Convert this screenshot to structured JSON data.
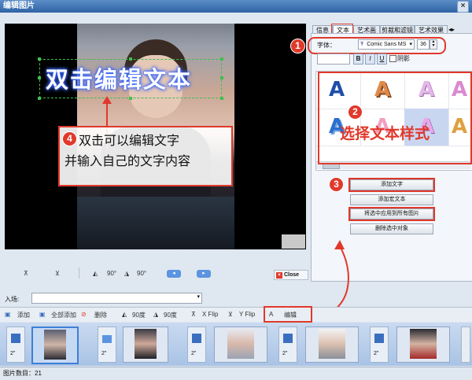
{
  "window": {
    "title": "编辑图片",
    "close_glyph": "×"
  },
  "canvas": {
    "overlay_text": "双击编辑文本",
    "callout": {
      "number": "4",
      "line1": "双击可以编辑文字",
      "line2": "并输入自己的文字内容"
    }
  },
  "tabs": [
    {
      "label": "信息",
      "active": false
    },
    {
      "label": "文本",
      "active": true
    },
    {
      "label": "艺术画",
      "active": false
    },
    {
      "label": "剪裁和滤镜",
      "active": false
    },
    {
      "label": "艺术效果",
      "active": false
    }
  ],
  "font_row": {
    "number": "1",
    "label": "字体：",
    "font_value": "Comic Sans MS",
    "size_value": "36"
  },
  "style_row": {
    "bold": "B",
    "italic": "I",
    "underline": "U",
    "shadow_label": "阴影"
  },
  "gallery": {
    "number": "2",
    "annotation": "选择文本样式",
    "glyph": "A"
  },
  "actions": {
    "number": "3",
    "add_text": "添加文字",
    "add_macro": "添加宏文本",
    "apply_all": "将选中应用到所有图片",
    "delete_selected": "删除选中对象"
  },
  "canvas_toolbar": {
    "rot1": "90°",
    "rot2": "90°",
    "close": "Close"
  },
  "entry": {
    "label": "入场:"
  },
  "bottom_toolbar": {
    "add": "添加",
    "add_all": "全部添加",
    "delete": "删除",
    "rot1": "90度",
    "rot2": "90度",
    "xflip": "X Flip",
    "yflip": "Y Flip",
    "edit": "编辑"
  },
  "filmstrip": {
    "duration": "2\""
  },
  "status": {
    "count_label": "图片数目：",
    "count_value": "21"
  }
}
